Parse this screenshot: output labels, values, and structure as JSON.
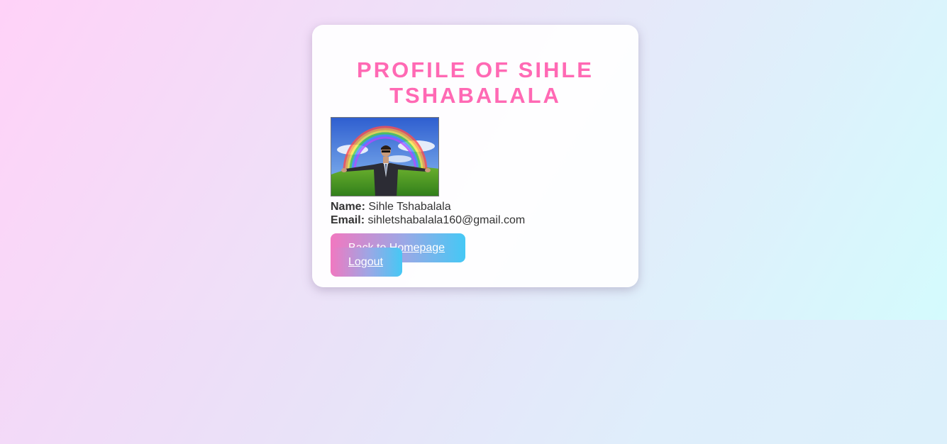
{
  "profile": {
    "title": "PROFILE OF SIHLE TSHABALALA",
    "photo_alt": "profile-picture",
    "name_label": "Name:",
    "name_value": "Sihle Tshabalala",
    "email_label": "Email:",
    "email_value": "sihletshabalala160@gmail.com"
  },
  "actions": {
    "home_label": "Back to Homepage",
    "logout_label": "Logout"
  },
  "colors": {
    "title": "#ff69b4",
    "button_gradient_start": "#f178c0",
    "button_gradient_end": "#45c8f5"
  }
}
